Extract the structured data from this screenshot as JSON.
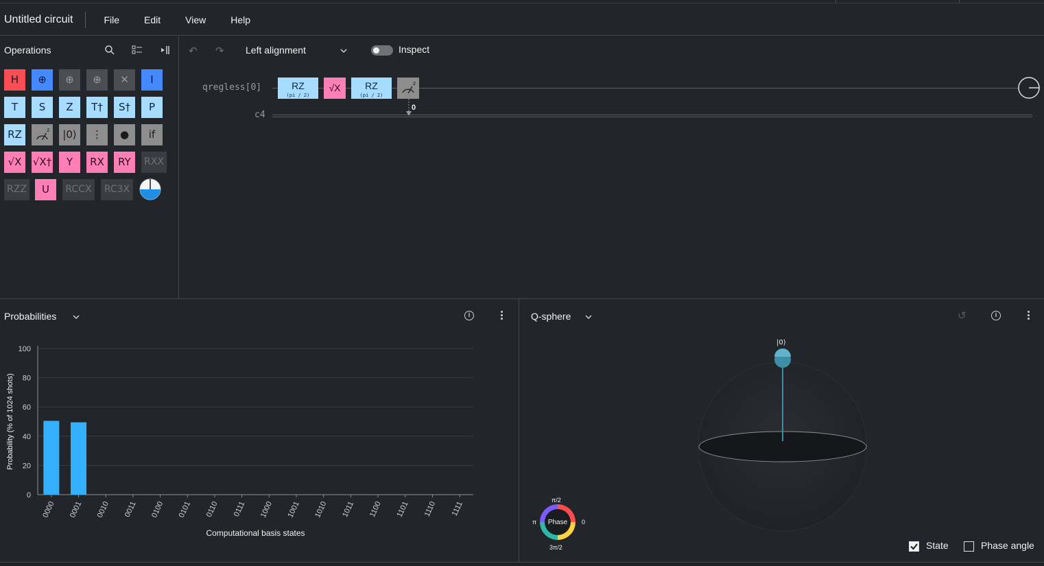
{
  "app": {
    "title": "Untitled circuit"
  },
  "menu": [
    "File",
    "Edit",
    "View",
    "Help"
  ],
  "operations": {
    "title": "Operations",
    "icons": [
      "search-icon",
      "list-view-icon",
      "collapse-panel-icon"
    ],
    "gates": [
      {
        "label": "H",
        "style": "red"
      },
      {
        "label": "⊕",
        "style": "blue"
      },
      {
        "label": "⊕",
        "style": "dgray"
      },
      {
        "label": "⊕",
        "style": "dgray"
      },
      {
        "label": "✕",
        "style": "dgray"
      },
      {
        "label": "I",
        "style": "blue"
      },
      {
        "label": "T",
        "style": "lblue"
      },
      {
        "label": "S",
        "style": "lblue"
      },
      {
        "label": "Z",
        "style": "lblue"
      },
      {
        "label": "T†",
        "style": "lblue"
      },
      {
        "label": "S†",
        "style": "lblue"
      },
      {
        "label": "P",
        "style": "lblue"
      },
      {
        "label": "RZ",
        "style": "lblue"
      },
      {
        "label": "",
        "style": "gray"
      },
      {
        "label": "|0⟩",
        "style": "gray"
      },
      {
        "label": "⋮",
        "style": "gray"
      },
      {
        "label": "●",
        "style": "gray"
      },
      {
        "label": "if",
        "style": "gray"
      },
      {
        "label": "√X",
        "style": "pink"
      },
      {
        "label": "√X†",
        "style": "pink"
      },
      {
        "label": "Y",
        "style": "pink"
      },
      {
        "label": "RX",
        "style": "pink"
      },
      {
        "label": "RY",
        "style": "pink"
      },
      {
        "label": "RXX",
        "style": "dis"
      },
      {
        "label": "RZZ",
        "style": "dis"
      },
      {
        "label": "U",
        "style": "pink"
      },
      {
        "label": "RCCX",
        "style": "dis"
      },
      {
        "label": "RC3X",
        "style": "dis"
      }
    ]
  },
  "editor": {
    "alignment": "Left alignment",
    "inspect_label": "Inspect",
    "inspect_on": false,
    "qubit_label": "qregless[0]",
    "creg_label": "c4",
    "measure_bit": "0",
    "circuit_gates": [
      {
        "label": "RZ",
        "param": "(pi / 2)",
        "style": "lblue"
      },
      {
        "label": "√X",
        "param": "",
        "style": "pink"
      },
      {
        "label": "RZ",
        "param": "(pi / 2)",
        "style": "lblue"
      }
    ]
  },
  "probabilities": {
    "title": "Probabilities",
    "chart_data": {
      "type": "bar",
      "categories": [
        "0000",
        "0001",
        "0010",
        "0011",
        "0100",
        "0101",
        "0110",
        "0111",
        "1000",
        "1001",
        "1010",
        "1011",
        "1100",
        "1101",
        "1110",
        "1111"
      ],
      "values": [
        50.5,
        49.5,
        0,
        0,
        0,
        0,
        0,
        0,
        0,
        0,
        0,
        0,
        0,
        0,
        0,
        0
      ],
      "xlabel": "Computational basis states",
      "ylabel": "Probability (% of 1024 shots)",
      "ylim": [
        0,
        100
      ],
      "yticks": [
        0,
        20,
        40,
        60,
        80,
        100
      ],
      "bar_color": "#33b1ff"
    }
  },
  "qsphere": {
    "title": "Q-sphere",
    "state_label": "|0⟩",
    "phase_wheel": {
      "center": "Phase",
      "top": "π/2",
      "left": "π",
      "right": "0",
      "bottom": "3π/2"
    },
    "state_checkbox": {
      "label": "State",
      "checked": true
    },
    "phase_checkbox": {
      "label": "Phase angle",
      "checked": false
    }
  }
}
